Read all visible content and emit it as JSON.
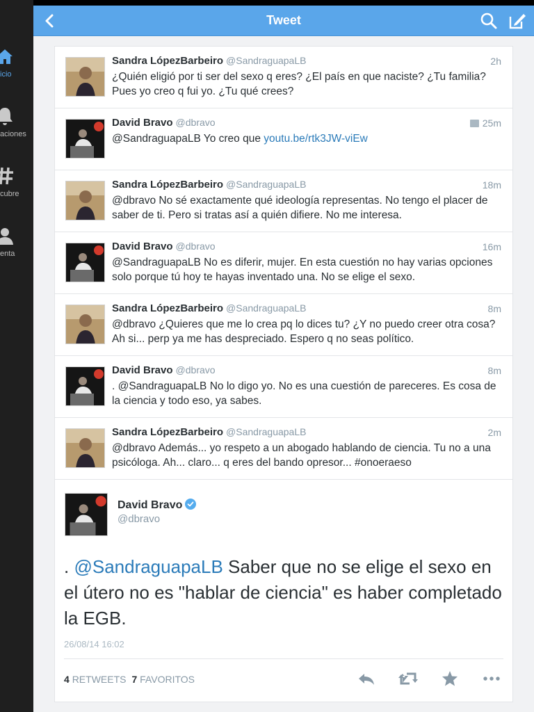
{
  "nav": {
    "title": "Tweet",
    "back_icon": "chevron-left-icon",
    "search_icon": "search-icon",
    "compose_icon": "compose-icon",
    "bar_color": "#5aa6ea"
  },
  "sidebar": {
    "items": [
      {
        "label": "icio",
        "icon": "home-icon",
        "active": true
      },
      {
        "label": "aciones",
        "icon": "bell-icon",
        "active": false
      },
      {
        "label": "cubre",
        "icon": "hashtag-icon",
        "active": false
      },
      {
        "label": "enta",
        "icon": "person-icon",
        "active": false
      }
    ]
  },
  "conversation": [
    {
      "name": "Sandra LópezBarbeiro",
      "handle": "@SandraguapaLB",
      "time": "2h",
      "text": "¿Quién eligió por ti ser del sexo q eres? ¿El país en que naciste? ¿Tu familia? Pues yo creo q fui yo. ¿Tu qué crees?"
    },
    {
      "name": "David Bravo",
      "handle": "@dbravo",
      "time": "25m",
      "has_media": true,
      "text_prefix": "@SandraguapaLB Yo creo que ",
      "link": "youtu.be/rtk3JW-viEw"
    },
    {
      "name": "Sandra LópezBarbeiro",
      "handle": "@SandraguapaLB",
      "time": "18m",
      "text": "@dbravo No sé exactamente qué ideología representas. No tengo el placer de saber de ti. Pero si tratas así a quién difiere. No me interesa."
    },
    {
      "name": "David Bravo",
      "handle": "@dbravo",
      "time": "16m",
      "text": "@SandraguapaLB No es diferir, mujer. En esta cuestión no hay varias opciones solo porque tú hoy te hayas inventado una. No se elige el sexo."
    },
    {
      "name": "Sandra LópezBarbeiro",
      "handle": "@SandraguapaLB",
      "time": "8m",
      "text": "@dbravo ¿Quieres que me lo crea pq lo dices tu? ¿Y no puedo creer otra cosa? Ah si... perp ya me has despreciado. Espero q no seas político."
    },
    {
      "name": "David Bravo",
      "handle": "@dbravo",
      "time": "8m",
      "text": ". @SandraguapaLB No lo digo yo. No es una cuestión de pareceres. Es cosa de la ciencia y todo eso, ya sabes."
    },
    {
      "name": "Sandra LópezBarbeiro",
      "handle": "@SandraguapaLB",
      "time": "2m",
      "text": "@dbravo Además... yo respeto a un abogado hablando de ciencia. Tu no a una psicóloga. Ah... claro... q eres del bando opresor... #onoeraeso"
    }
  ],
  "detail": {
    "name": "David Bravo",
    "handle": "@dbravo",
    "verified": true,
    "text_lead": ". ",
    "mention": "@SandraguapaLB",
    "text_rest": " Saber que no se elige el sexo en el útero no es \"hablar de ciencia\" es haber completado la EGB.",
    "date": "26/08/14 16:02",
    "retweets_count": "4",
    "retweets_label": "RETWEETS",
    "favorites_count": "7",
    "favorites_label": "FAVORITOS",
    "actions": [
      "reply-icon",
      "retweet-icon",
      "favorite-icon",
      "more-icon"
    ]
  },
  "colors": {
    "link": "#2b7bb9",
    "muted": "#8899a6",
    "text": "#292f33",
    "verified": "#55acee"
  }
}
